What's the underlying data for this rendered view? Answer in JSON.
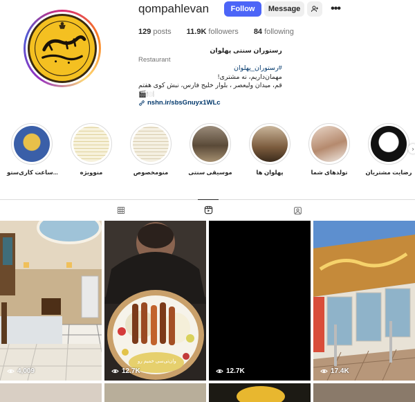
{
  "profile": {
    "username": "qompahlevan",
    "follow_label": "Follow",
    "message_label": "Message",
    "more_label": "•••",
    "stats": {
      "posts_count": "129",
      "posts_label": "posts",
      "followers_count": "11.9K",
      "followers_label": "followers",
      "following_count": "84",
      "following_label": "following"
    },
    "bio": {
      "name": "رستوران سنتی پهلوان",
      "category": "Restaurant",
      "hashtag": "#رستوران_پهلوان",
      "line1": "مهمان‌داریم، نه مشتری!",
      "line2": "قم، میدان ولیعصر ، بلوار خلیج فارس، نبش کوی هفتم",
      "line3": "🎬🍽️",
      "link": "nshn.ir/sbsGnuyx1WLc"
    },
    "avatar_text": "رستوران پهلوان"
  },
  "highlights": [
    {
      "label": "رضایت مشتریان"
    },
    {
      "label": "تولدهای شما"
    },
    {
      "label": "پهلوان ها"
    },
    {
      "label": "موسیقی سنتی"
    },
    {
      "label": "منومخصوص"
    },
    {
      "label": "منوویژه"
    },
    {
      "label": "ساعت کاری‌ستو..."
    }
  ],
  "tabs": [
    {
      "name": "posts",
      "icon": "grid-icon"
    },
    {
      "name": "reels",
      "icon": "reels-icon"
    },
    {
      "name": "tagged",
      "icon": "tagged-icon"
    }
  ],
  "posts": [
    {
      "views": "4,009"
    },
    {
      "views": "12.7K",
      "caption": "وان‌تی‌سی خمیم رو"
    },
    {
      "views": "12.7K"
    },
    {
      "views": "17.4K"
    }
  ],
  "colors": {
    "follow_blue": "#4c65f7",
    "link_blue": "#00376b",
    "avatar_yellow": "#f4c021"
  }
}
